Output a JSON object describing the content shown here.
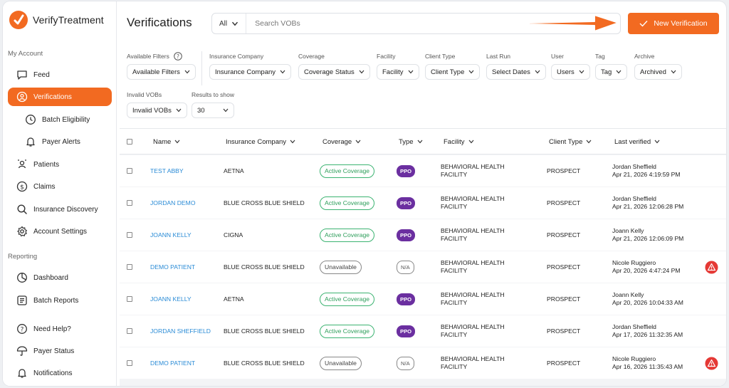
{
  "app": {
    "name": "VerifyTreatment"
  },
  "colors": {
    "accent": "#f26a21",
    "link": "#2a8bd6",
    "coverage_active": "#2e9e5b",
    "type_badge": "#6b2fa0",
    "alert": "#e53935"
  },
  "sidebar": {
    "sections": [
      {
        "label": "My Account"
      },
      {
        "label": "Reporting"
      }
    ],
    "items": [
      {
        "label": "Feed",
        "icon": "chat-icon"
      },
      {
        "label": "Verifications",
        "icon": "user-check-icon",
        "active": true
      },
      {
        "label": "Batch Eligibility",
        "icon": "clock-icon"
      },
      {
        "label": "Payer Alerts",
        "icon": "bell-icon"
      },
      {
        "label": "Patients",
        "icon": "users-icon"
      },
      {
        "label": "Claims",
        "icon": "dollar-icon"
      },
      {
        "label": "Insurance Discovery",
        "icon": "search-icon"
      },
      {
        "label": "Account Settings",
        "icon": "gear-icon"
      },
      {
        "label": "Dashboard",
        "icon": "pie-chart-icon"
      },
      {
        "label": "Batch Reports",
        "icon": "list-icon"
      },
      {
        "label": "Need Help?",
        "icon": "help-icon"
      },
      {
        "label": "Payer Status",
        "icon": "umbrella-icon"
      },
      {
        "label": "Notifications",
        "icon": "bell-icon"
      }
    ]
  },
  "header": {
    "title": "Verifications",
    "search_scope": "All",
    "search_placeholder": "Search VOBs",
    "new_button": "New Verification"
  },
  "filters": [
    {
      "label": "Available Filters",
      "value": "Available Filters"
    },
    {
      "label": "Insurance Company",
      "value": "Insurance Company"
    },
    {
      "label": "Coverage",
      "value": "Coverage Status"
    },
    {
      "label": "Facility",
      "value": "Facility"
    },
    {
      "label": "Client Type",
      "value": "Client Type"
    },
    {
      "label": "Last Run",
      "value": "Select Dates"
    },
    {
      "label": "User",
      "value": "Users"
    },
    {
      "label": "Tag",
      "value": "Tag"
    },
    {
      "label": "Archive",
      "value": "Archived"
    },
    {
      "label": "Invalid VOBs",
      "value": "Invalid VOBs"
    },
    {
      "label": "Results to show",
      "value": "30"
    }
  ],
  "table": {
    "columns": [
      "Name",
      "Insurance Company",
      "Coverage",
      "Type",
      "Facility",
      "Client Type",
      "Last verified"
    ],
    "rows": [
      {
        "name": "TEST ABBY",
        "insurance": "AETNA",
        "coverage": "Active Coverage",
        "type": "PPO",
        "facility": "BEHAVIORAL HEALTH FACILITY",
        "client_type": "PROSPECT",
        "verified_by": "Jordan Sheffield",
        "verified_at": "Apr 21, 2026 4:19:59 PM",
        "alert": false
      },
      {
        "name": "JORDAN DEMO",
        "insurance": "BLUE CROSS BLUE SHIELD",
        "coverage": "Active Coverage",
        "type": "PPO",
        "facility": "BEHAVIORAL HEALTH FACILITY",
        "client_type": "PROSPECT",
        "verified_by": "Jordan Sheffield",
        "verified_at": "Apr 21, 2026 12:06:28 PM",
        "alert": false
      },
      {
        "name": "JOANN KELLY",
        "insurance": "CIGNA",
        "coverage": "Active Coverage",
        "type": "PPO",
        "facility": "BEHAVIORAL HEALTH FACILITY",
        "client_type": "PROSPECT",
        "verified_by": "Joann Kelly",
        "verified_at": "Apr 21, 2026 12:06:09 PM",
        "alert": false
      },
      {
        "name": "DEMO PATIENT",
        "insurance": "BLUE CROSS BLUE SHIELD",
        "coverage": "Unavailable",
        "type": "N/A",
        "facility": "BEHAVIORAL HEALTH FACILITY",
        "client_type": "PROSPECT",
        "verified_by": "Nicole Ruggiero",
        "verified_at": "Apr 20, 2026 4:47:24 PM",
        "alert": true
      },
      {
        "name": "JOANN KELLY",
        "insurance": "AETNA",
        "coverage": "Active Coverage",
        "type": "PPO",
        "facility": "BEHAVIORAL HEALTH FACILITY",
        "client_type": "PROSPECT",
        "verified_by": "Joann Kelly",
        "verified_at": "Apr 20, 2026 10:04:33 AM",
        "alert": false
      },
      {
        "name": "JORDAN SHEFFIELD",
        "insurance": "BLUE CROSS BLUE SHIELD",
        "coverage": "Active Coverage",
        "type": "PPO",
        "facility": "BEHAVIORAL HEALTH FACILITY",
        "client_type": "PROSPECT",
        "verified_by": "Jordan Sheffield",
        "verified_at": "Apr 17, 2026 11:32:35 AM",
        "alert": false
      },
      {
        "name": "DEMO PATIENT",
        "insurance": "BLUE CROSS BLUE SHIELD",
        "coverage": "Unavailable",
        "type": "N/A",
        "facility": "BEHAVIORAL HEALTH FACILITY",
        "client_type": "PROSPECT",
        "verified_by": "Nicole Ruggiero",
        "verified_at": "Apr 16, 2026 11:35:43 AM",
        "alert": true
      }
    ]
  }
}
